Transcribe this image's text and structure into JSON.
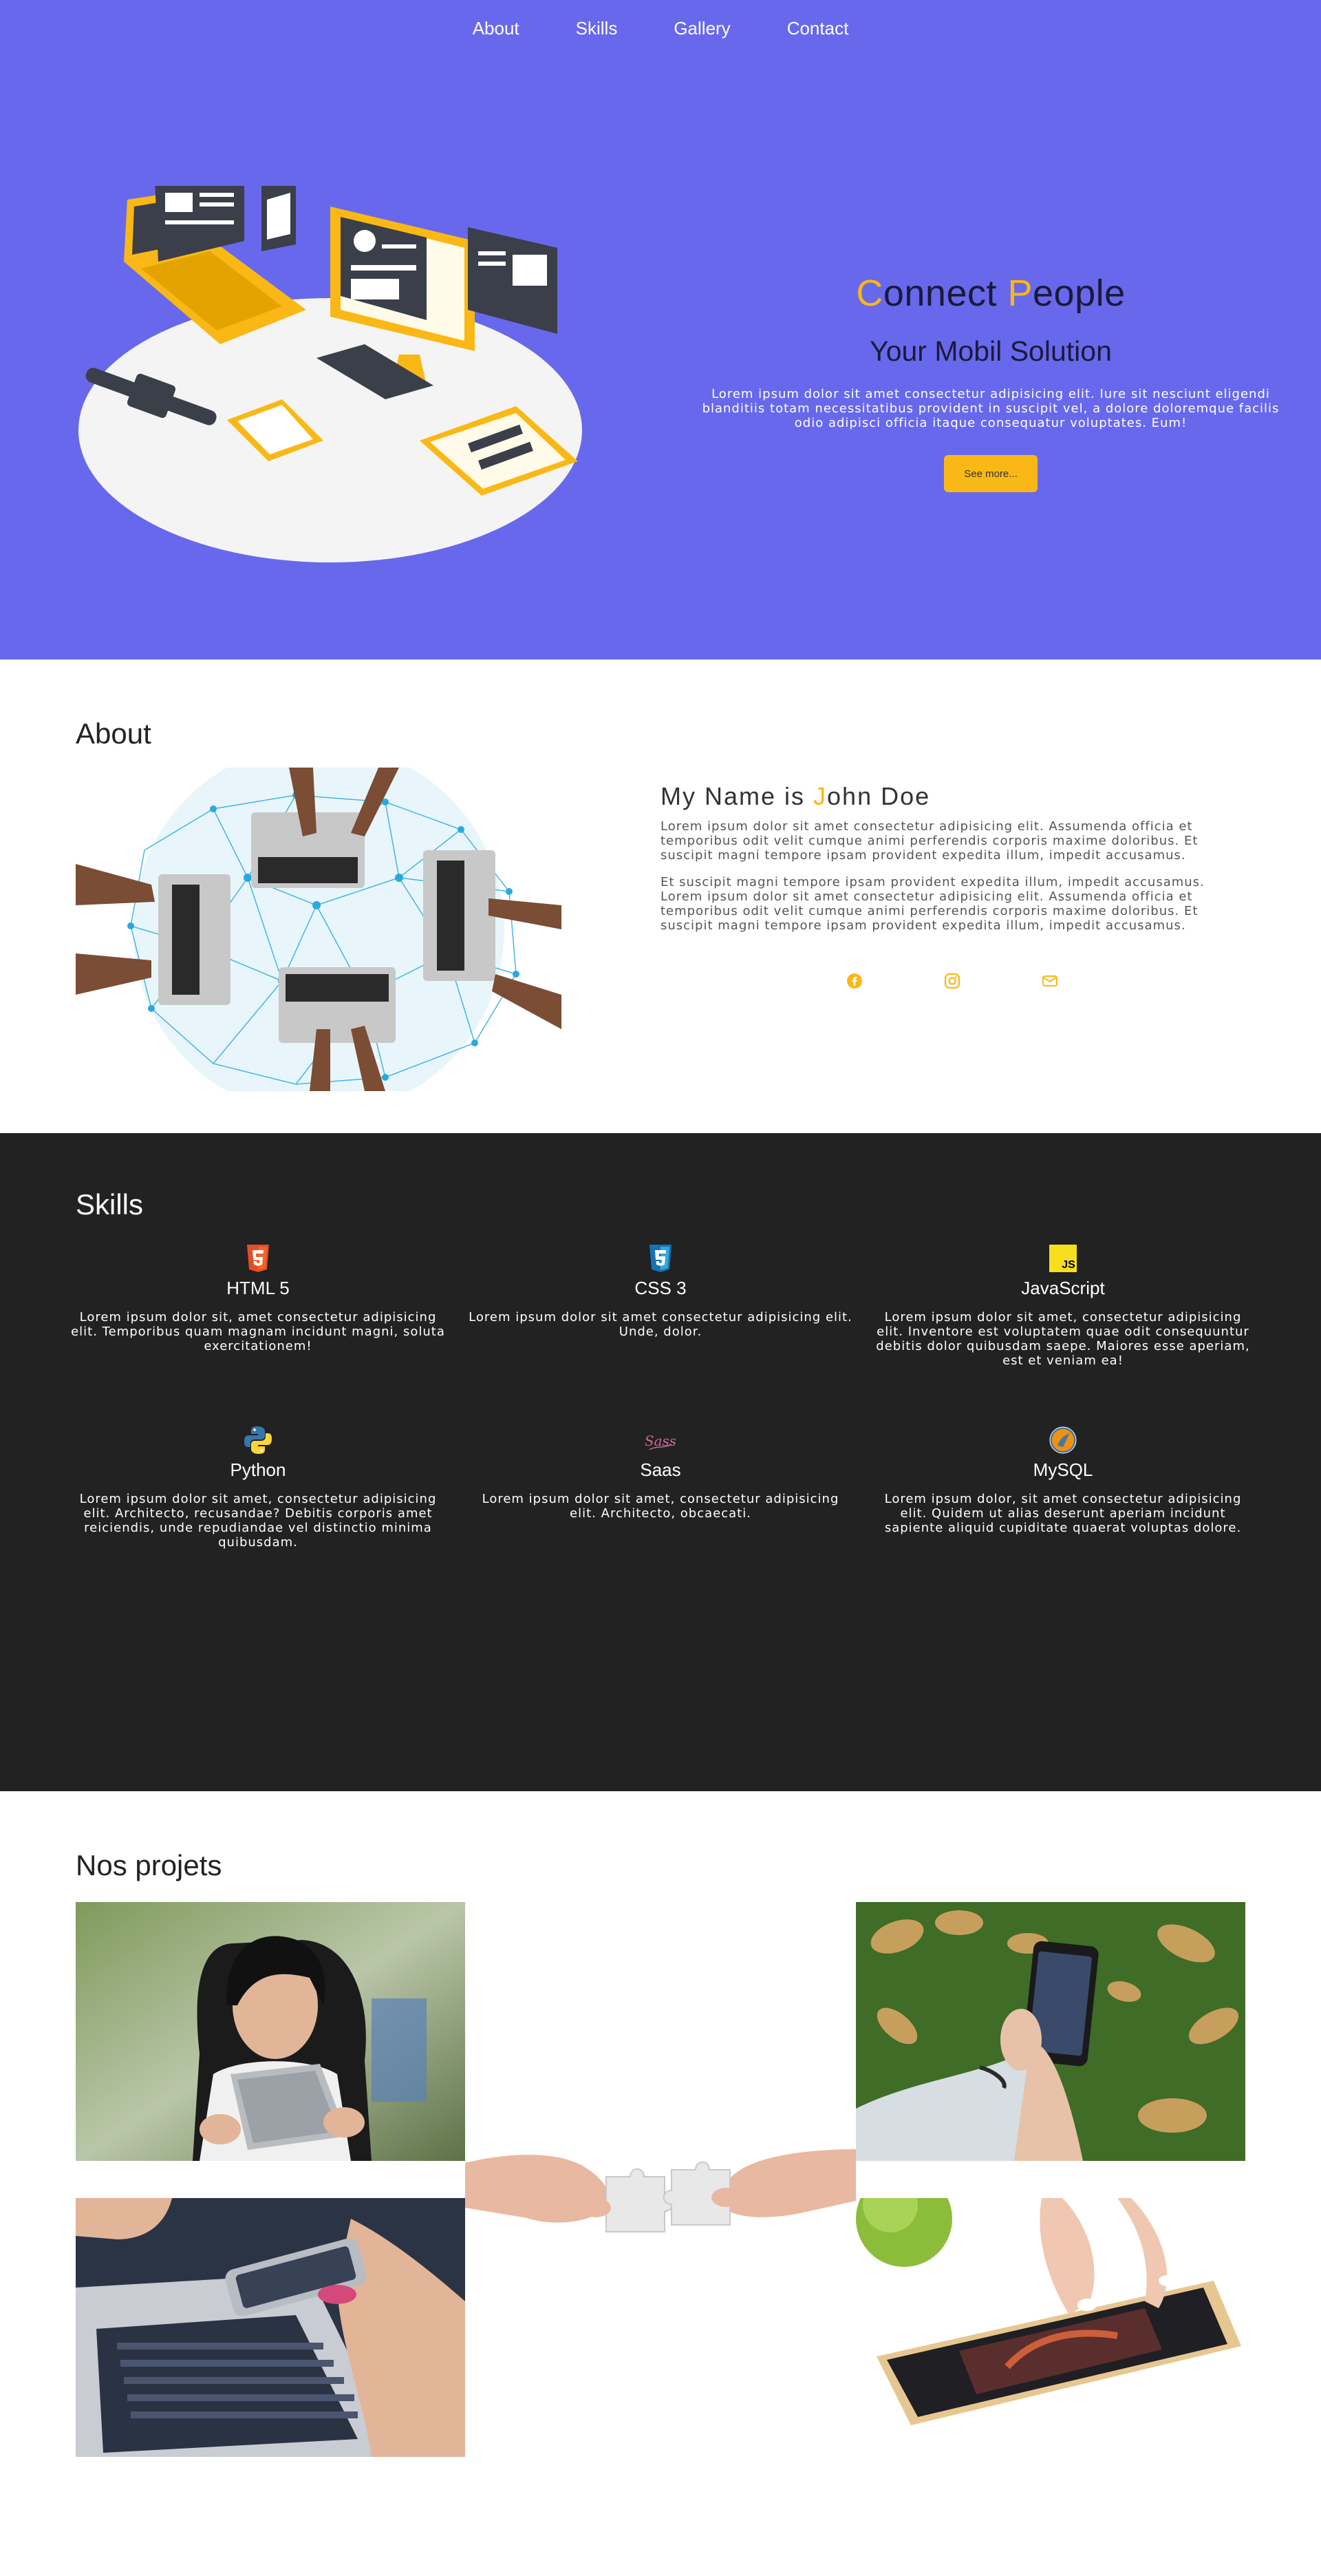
{
  "nav": {
    "items": [
      "About",
      "Skills",
      "Gallery",
      "Contact"
    ]
  },
  "hero": {
    "title_first_letter": "C",
    "title_part1": "onnect ",
    "title_second_letter": "P",
    "title_part2": "eople",
    "subtitle": "Your Mobil Solution",
    "paragraph": "Lorem ipsum dolor sit amet consectetur adipisicing elit. Iure sit nesciunt eligendi blanditiis totam necessitatibus provident in suscipit vel, a dolore doloremque facilis odio adipisci officia itaque consequatur voluptates. Eum!",
    "button_label": "See more..."
  },
  "about": {
    "title": "About",
    "name_prefix": "My Name is ",
    "name_first_letter": "J",
    "name_rest": "ohn Doe",
    "paragraph1": "Lorem ipsum dolor sit amet consectetur adipisicing elit. Assumenda officia et temporibus odit velit cumque animi perferendis corporis maxime doloribus. Et suscipit magni tempore ipsam provident expedita illum, impedit accusamus.",
    "paragraph2": "Et suscipit magni tempore ipsam provident expedita illum, impedit accusamus. Lorem ipsum dolor sit amet consectetur adipisicing elit. Assumenda officia et temporibus odit velit cumque animi perferendis corporis maxime doloribus. Et suscipit magni tempore ipsam provident expedita illum, impedit accusamus.",
    "socials": [
      "facebook-icon",
      "instagram-icon",
      "email-icon"
    ]
  },
  "skills": {
    "title": "Skills",
    "items": [
      {
        "name": "HTML 5",
        "icon": "html5-icon",
        "desc": "Lorem ipsum dolor sit, amet consectetur adipisicing elit. Temporibus quam magnam incidunt magni, soluta exercitationem!"
      },
      {
        "name": "CSS 3",
        "icon": "css3-icon",
        "desc": "Lorem ipsum dolor sit amet consectetur adipisicing elit. Unde, dolor."
      },
      {
        "name": "JavaScript",
        "icon": "javascript-icon",
        "desc": "Lorem ipsum dolor sit amet, consectetur adipisicing elit. Inventore est voluptatem quae odit consequuntur debitis dolor quibusdam saepe. Maiores esse aperiam, est et veniam ea!"
      },
      {
        "name": "Python",
        "icon": "python-icon",
        "desc": "Lorem ipsum dolor sit amet, consectetur adipisicing elit. Architecto, recusandae? Debitis corporis amet reiciendis, unde repudiandae vel distinctio minima quibusdam."
      },
      {
        "name": "Saas",
        "icon": "sass-icon",
        "desc": "Lorem ipsum dolor sit amet, consectetur adipisicing elit. Architecto, obcaecati."
      },
      {
        "name": "MySQL",
        "icon": "mysql-icon",
        "desc": "Lorem ipsum dolor, sit amet consectetur adipisicing elit. Quidem ut alias deserunt aperiam incidunt sapiente aliquid cupiditate quaerat voluptas dolore."
      }
    ]
  },
  "projects": {
    "title": "Nos projets"
  },
  "colors": {
    "hero_bg": "#6868ec",
    "accent": "#f9b815",
    "skills_bg": "#222222"
  }
}
